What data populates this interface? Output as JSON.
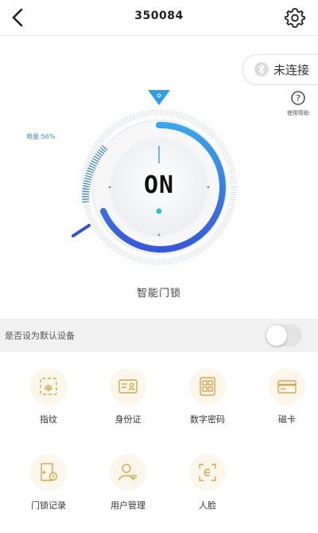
{
  "header": {
    "title": "350084"
  },
  "connection": {
    "status_label": "未连接"
  },
  "help": {
    "label": "使用帮助"
  },
  "dial": {
    "battery_label": "电量:56%",
    "battery_percent": 56,
    "state_label": "ON"
  },
  "lock": {
    "name": "智能门锁"
  },
  "default_device": {
    "label": "是否设为默认设备",
    "enabled": false
  },
  "features": [
    {
      "label": "指纹",
      "icon": "fingerprint-icon"
    },
    {
      "label": "身份证",
      "icon": "id-card-icon"
    },
    {
      "label": "数字密码",
      "icon": "password-keypad-icon"
    },
    {
      "label": "磁卡",
      "icon": "magnetic-card-icon"
    },
    {
      "label": "门锁记录",
      "icon": "door-log-icon"
    },
    {
      "label": "用户管理",
      "icon": "user-management-icon"
    },
    {
      "label": "人脸",
      "icon": "face-icon"
    }
  ],
  "colors": {
    "accent": "#2f8be0",
    "accent_dark": "#3b5fe0",
    "icon_bg": "#fdf6ea",
    "icon_stroke": "#d9a54a"
  }
}
